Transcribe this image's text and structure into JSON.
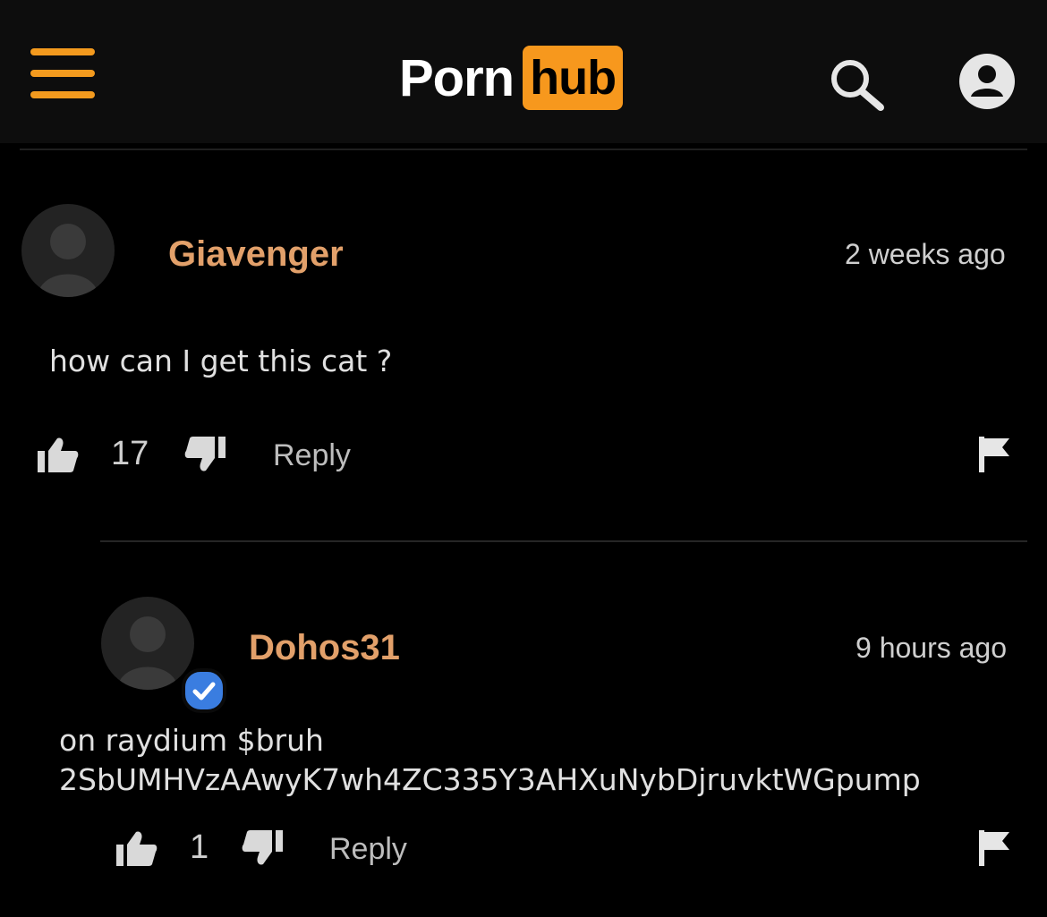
{
  "header": {
    "logo_left": "Porn",
    "logo_right": "hub",
    "menu_icon": "hamburger-menu-icon",
    "search_icon": "search-icon",
    "account_icon": "user-account-icon",
    "accent_color": "#f7981d"
  },
  "comments": [
    {
      "username": "Giavenger",
      "time": "2 weeks ago",
      "text": "how can I get this cat ?",
      "likes": "17",
      "reply_label": "Reply"
    },
    {
      "username": "Dohos31",
      "time": "9 hours ago",
      "text_line1": "on raydium $bruh",
      "text_line2": "2SbUMHVzAAwyK7wh4ZC335Y3AHXuNybDjruvktWGpump",
      "likes": "1",
      "reply_label": "Reply",
      "verified": true
    }
  ]
}
